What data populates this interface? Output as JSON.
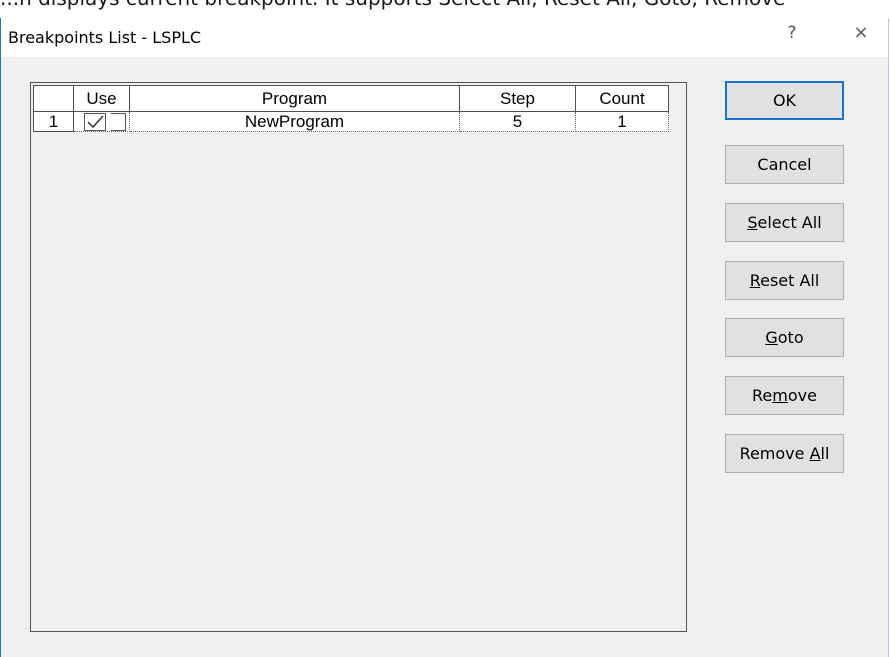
{
  "background_text": "...n displays current breakpoint. It supports Select All, Reset All, Goto, Remove",
  "dialog": {
    "title": "Breakpoints List - LSPLC",
    "help_glyph": "?",
    "close_glyph": "×"
  },
  "table": {
    "columns": [
      "Use",
      "Program",
      "Step",
      "Count"
    ],
    "rows": [
      {
        "index": "1",
        "use": true,
        "program": "NewProgram",
        "step": "5",
        "count": "1"
      }
    ]
  },
  "buttons": {
    "ok": "OK",
    "cancel": "Cancel",
    "select_all": {
      "pre": "",
      "mnemonic": "S",
      "post": "elect All"
    },
    "reset_all": {
      "pre": "",
      "mnemonic": "R",
      "post": "eset All"
    },
    "goto": {
      "pre": "",
      "mnemonic": "G",
      "post": "oto"
    },
    "remove": {
      "pre": "Re",
      "mnemonic": "m",
      "post": "ove"
    },
    "remove_all": {
      "pre": "Remove ",
      "mnemonic": "A",
      "post": "ll"
    }
  },
  "colors": {
    "dialog_bg": "#f0f0f0",
    "accent": "#1874d1",
    "button_bg": "#e1e1e1"
  }
}
